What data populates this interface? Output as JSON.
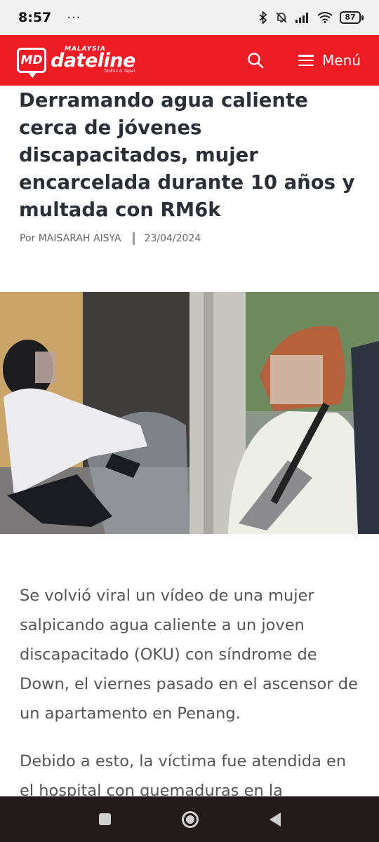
{
  "status_bar": {
    "time": "8:57",
    "more_dots": "···",
    "battery": "87"
  },
  "header": {
    "logo_md": "MD",
    "logo_country": "MALAYSIA",
    "logo_name": "dateline",
    "logo_tagline": "Terkini & Tepat",
    "menu_label": "Menú",
    "accent_color": "#ee1c24"
  },
  "article": {
    "title": "Derramando agua caliente cerca de jóvenes discapacitados, mujer encarcelada durante 10 años y multada con RM6k",
    "author": "Por MAISARAH AISYA",
    "date": "23/04/2024",
    "paragraphs": [
      "Se volvió viral un vídeo de una mujer salpicando agua caliente a un joven discapacitado (OKU) con síndrome de Down, el viernes pasado en el ascensor de un apartamento en Penang.",
      "Debido a esto, la víctima fue atendida en el hospital con quemaduras en la"
    ]
  }
}
